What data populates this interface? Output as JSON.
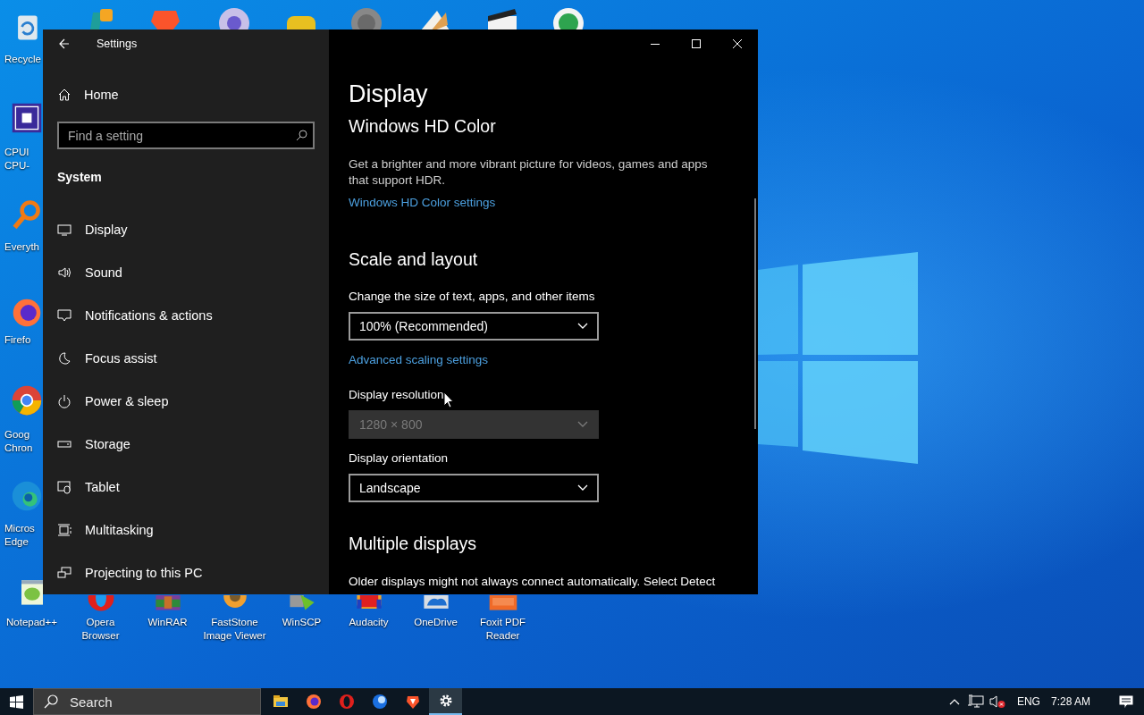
{
  "desktop": {
    "icons": [
      {
        "kind": "recycle",
        "label": "Recycle"
      },
      {
        "kind": "cpuz",
        "label": "CPUI CPU-"
      },
      {
        "kind": "everything",
        "label": "Everyth"
      },
      {
        "kind": "firefox",
        "label": "Firefo"
      },
      {
        "kind": "chrome",
        "label": "Goog Chron"
      },
      {
        "kind": "edge",
        "label": "Micros Edge"
      },
      {
        "kind": "notepad",
        "label": "Notepad++"
      },
      {
        "kind": "opera",
        "label": "Opera Browser"
      },
      {
        "kind": "winrar",
        "label": "WinRAR"
      },
      {
        "kind": "faststone",
        "label": "FastStone Image Viewer"
      },
      {
        "kind": "winscp",
        "label": "WinSCP"
      },
      {
        "kind": "audacity",
        "label": "Audacity"
      },
      {
        "kind": "onedrive",
        "label": "OneDrive"
      },
      {
        "kind": "foxit",
        "label": "Foxit PDF Reader"
      }
    ]
  },
  "settings": {
    "title": "Settings",
    "home": "Home",
    "search": {
      "placeholder": "Find a setting"
    },
    "group": "System",
    "nav": [
      {
        "kind": "display",
        "label": "Display"
      },
      {
        "kind": "sound",
        "label": "Sound"
      },
      {
        "kind": "notifications",
        "label": "Notifications & actions"
      },
      {
        "kind": "focus",
        "label": "Focus assist"
      },
      {
        "kind": "power",
        "label": "Power & sleep"
      },
      {
        "kind": "storage",
        "label": "Storage"
      },
      {
        "kind": "tablet",
        "label": "Tablet"
      },
      {
        "kind": "multitasking",
        "label": "Multitasking"
      },
      {
        "kind": "projecting",
        "label": "Projecting to this PC"
      }
    ],
    "page_title": "Display",
    "content": [
      {
        "kind": "heading",
        "text": "Windows HD Color"
      },
      {
        "kind": "text",
        "text": "Get a brighter and more vibrant picture for videos, games and apps that support HDR."
      },
      {
        "kind": "link",
        "text": "Windows HD Color settings"
      },
      {
        "kind": "heading",
        "text": "Scale and layout"
      },
      {
        "kind": "label",
        "text": "Change the size of text, apps, and other items"
      },
      {
        "kind": "dropdown",
        "value": "100% (Recommended)",
        "disabled": false
      },
      {
        "kind": "link",
        "text": "Advanced scaling settings"
      },
      {
        "kind": "label",
        "text": "Display resolution"
      },
      {
        "kind": "dropdown",
        "value": "1280 × 800",
        "disabled": true
      },
      {
        "kind": "label",
        "text": "Display orientation"
      },
      {
        "kind": "dropdown",
        "value": "Landscape",
        "disabled": false
      },
      {
        "kind": "heading",
        "text": "Multiple displays"
      },
      {
        "kind": "text",
        "text": "Older displays might not always connect automatically. Select Detect"
      }
    ]
  },
  "taskbar": {
    "search": {
      "placeholder": "Search"
    },
    "apps": [
      {
        "kind": "explorer",
        "selected": false
      },
      {
        "kind": "firefox",
        "selected": false
      },
      {
        "kind": "opera",
        "selected": false
      },
      {
        "kind": "thunderbird",
        "selected": false
      },
      {
        "kind": "brave",
        "selected": false
      },
      {
        "kind": "settings",
        "selected": true
      }
    ],
    "tray": {
      "volume_muted": true,
      "language": "ENG",
      "time": "7:28 AM"
    }
  }
}
